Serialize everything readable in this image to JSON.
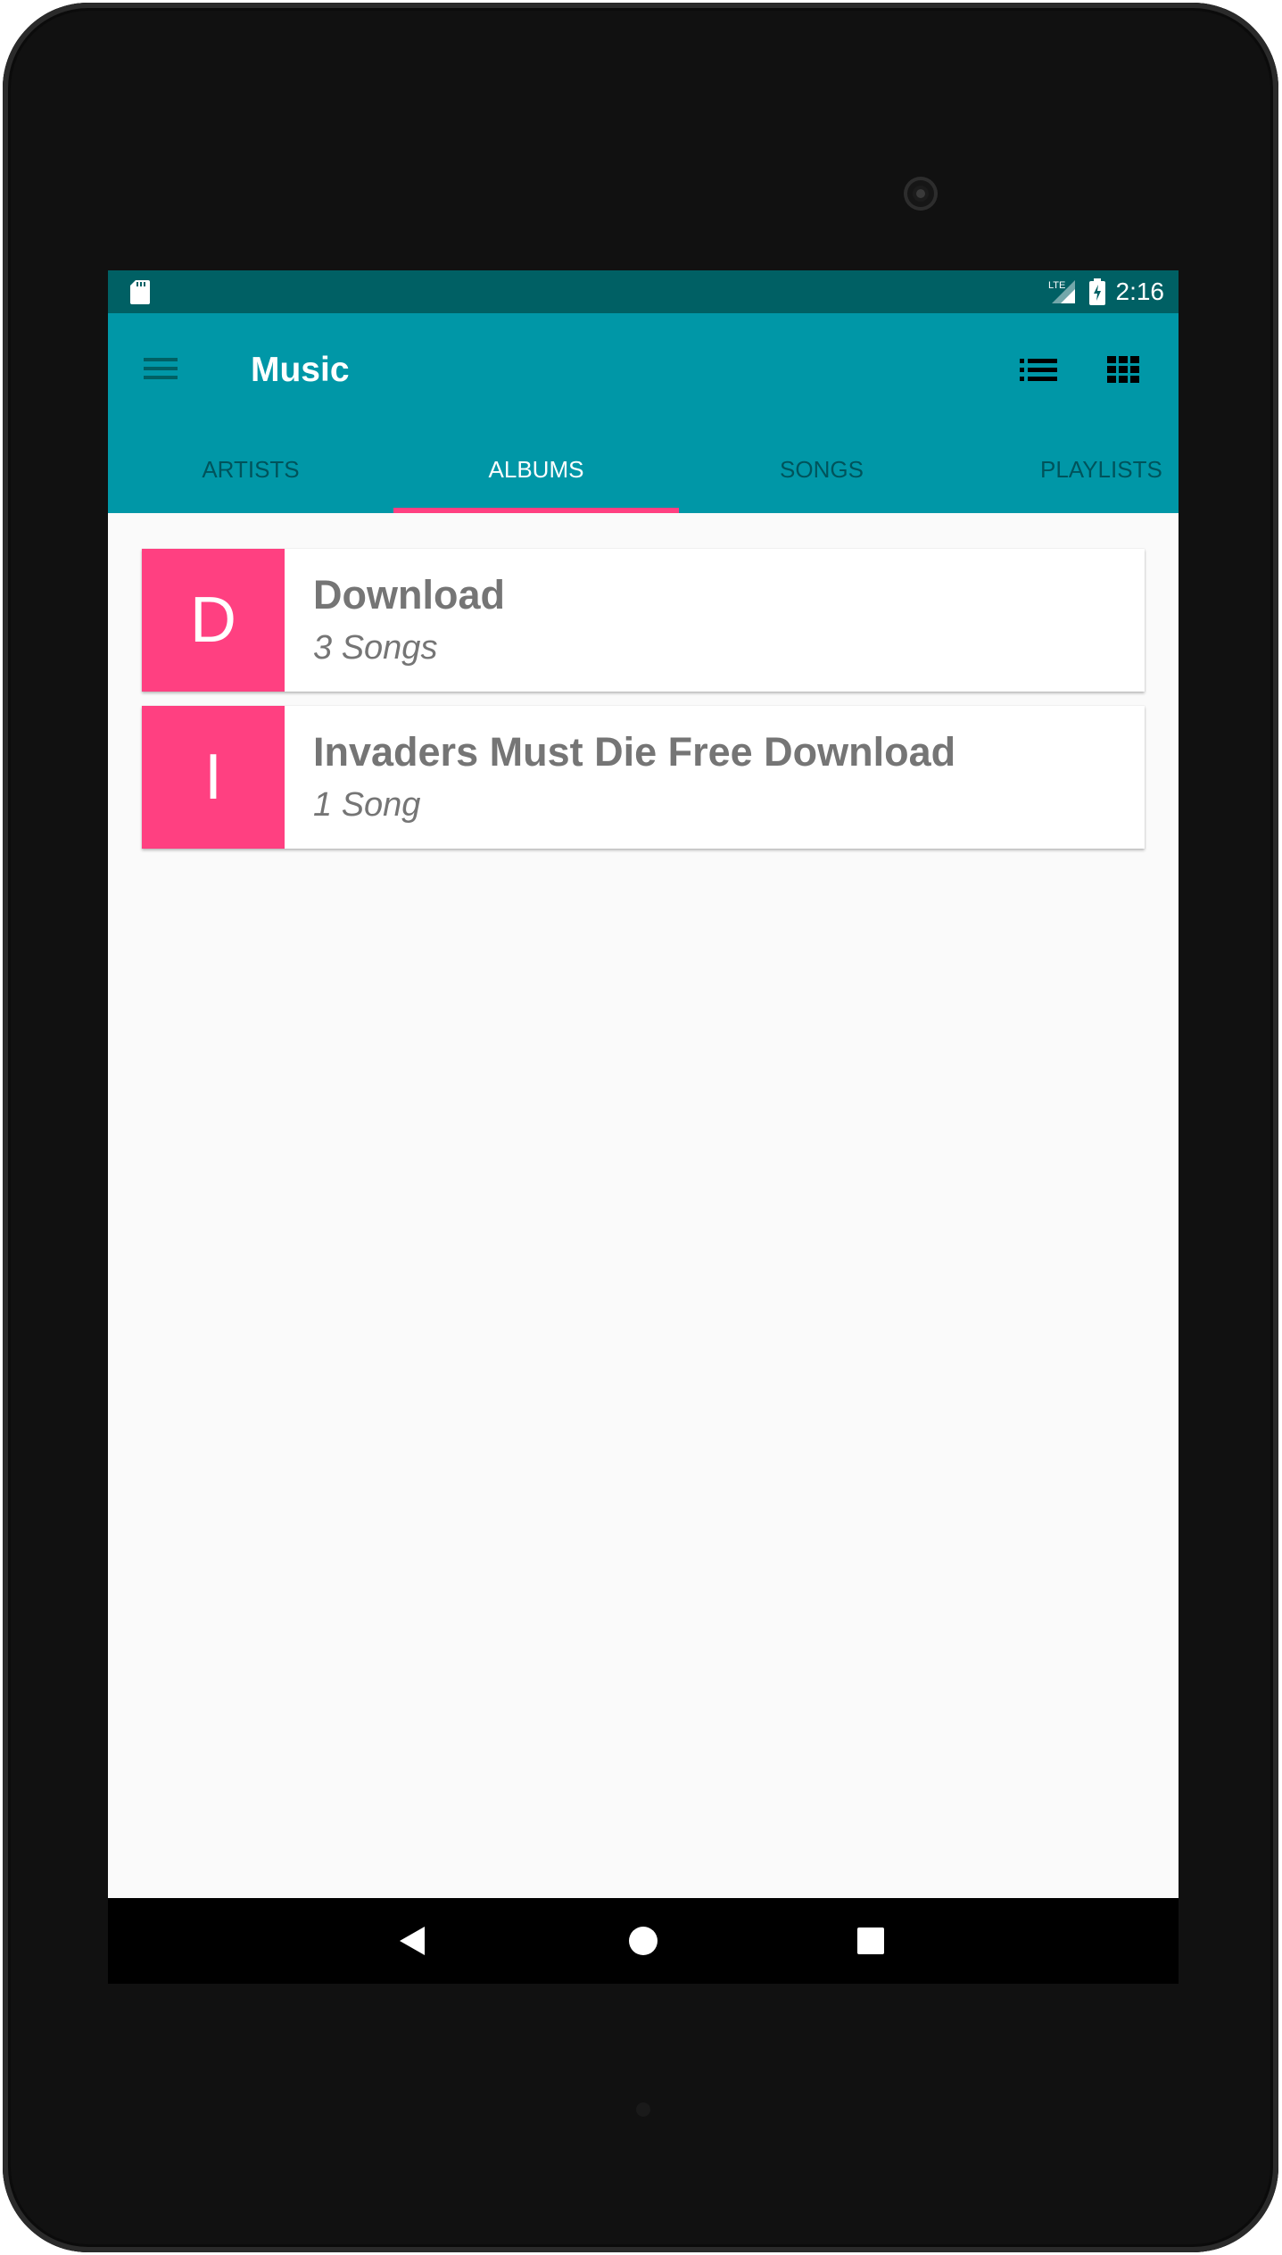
{
  "status_bar": {
    "time": "2:16",
    "network_label": "LTE",
    "icons": [
      "sd-card-icon",
      "signal-icon",
      "battery-charging-icon"
    ]
  },
  "app_bar": {
    "title": "Music",
    "icons": [
      "menu-icon",
      "list-view-icon",
      "grid-view-icon"
    ]
  },
  "tabs": [
    {
      "label": "ARTISTS",
      "active": false
    },
    {
      "label": "ALBUMS",
      "active": true
    },
    {
      "label": "SONGS",
      "active": false
    },
    {
      "label": "PLAYLISTS",
      "active": false
    }
  ],
  "albums": [
    {
      "initial": "D",
      "title": "Download",
      "subtitle": "3 Songs"
    },
    {
      "initial": "I",
      "title": "Invaders Must Die Free Download",
      "subtitle": "1 Song"
    }
  ],
  "nav_bar": {
    "icons": [
      "back-icon",
      "home-icon",
      "recents-icon"
    ]
  },
  "colors": {
    "status_bar": "#006064",
    "primary": "#0097a7",
    "accent": "#ff4081",
    "text_secondary": "#757575",
    "background": "#fafafa"
  }
}
